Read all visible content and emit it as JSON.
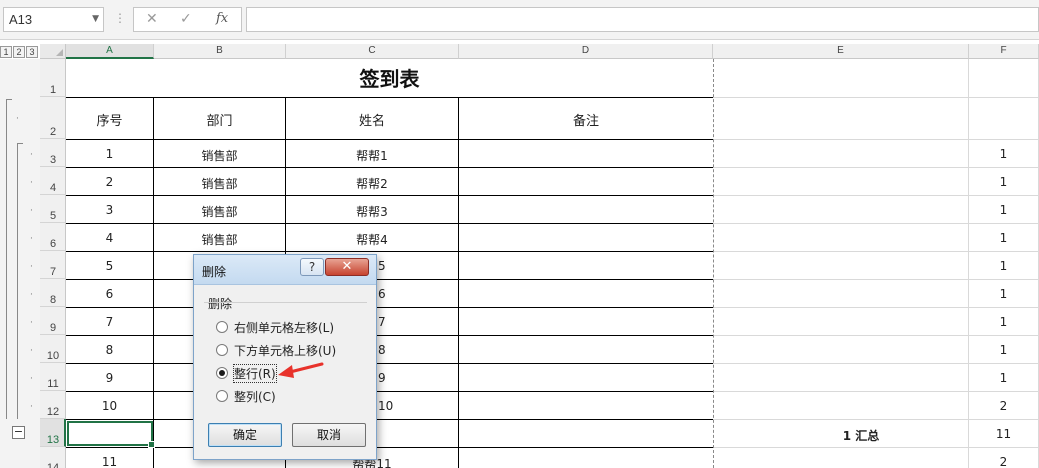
{
  "formula_bar": {
    "name_box": "A13",
    "separator": "⋮",
    "cancel_icon": "✕",
    "enter_icon": "✓",
    "fx_icon": "fx",
    "formula": ""
  },
  "outline_levels": [
    "1",
    "2",
    "3"
  ],
  "collapse_symbol": "−",
  "columns": [
    "A",
    "B",
    "C",
    "D",
    "E",
    "F"
  ],
  "selected_column": "A",
  "rows": [
    "1",
    "2",
    "3",
    "4",
    "5",
    "6",
    "7",
    "8",
    "9",
    "10",
    "11",
    "12",
    "13",
    "14"
  ],
  "selected_row": "13",
  "sheet": {
    "title": "签到表",
    "headers": [
      "序号",
      "部门",
      "姓名",
      "备注"
    ],
    "data_rows": [
      {
        "no": "1",
        "dept": "销售部",
        "name": "帮帮1",
        "note": "",
        "f": "1"
      },
      {
        "no": "2",
        "dept": "销售部",
        "name": "帮帮2",
        "note": "",
        "f": "1"
      },
      {
        "no": "3",
        "dept": "销售部",
        "name": "帮帮3",
        "note": "",
        "f": "1"
      },
      {
        "no": "4",
        "dept": "销售部",
        "name": "帮帮4",
        "note": "",
        "f": "1"
      },
      {
        "no": "5",
        "dept": "",
        "name": "5",
        "note": "",
        "f": "1"
      },
      {
        "no": "6",
        "dept": "",
        "name": "6",
        "note": "",
        "f": "1"
      },
      {
        "no": "7",
        "dept": "",
        "name": "7",
        "note": "",
        "f": "1"
      },
      {
        "no": "8",
        "dept": "",
        "name": "8",
        "note": "",
        "f": "1"
      },
      {
        "no": "9",
        "dept": "",
        "name": "9",
        "note": "",
        "f": "1"
      },
      {
        "no": "10",
        "dept": "",
        "name": "10",
        "note": "",
        "f": "2"
      }
    ],
    "summary_row": {
      "label": "1 汇总",
      "f": "11"
    },
    "last_row": {
      "no": "11",
      "dept": "",
      "name": "帮帮11",
      "f": "2"
    }
  },
  "dialog": {
    "title": "删除",
    "help": "?",
    "close": "✕",
    "group_label": "删除",
    "options": [
      {
        "label": "右侧单元格左移(L)",
        "checked": false
      },
      {
        "label": "下方单元格上移(U)",
        "checked": false
      },
      {
        "label": "整行(R)",
        "checked": true
      },
      {
        "label": "整列(C)",
        "checked": false
      }
    ],
    "ok": "确定",
    "cancel": "取消"
  },
  "colors": {
    "selection_green": "#217346",
    "annotation_arrow": "#e8322b"
  }
}
